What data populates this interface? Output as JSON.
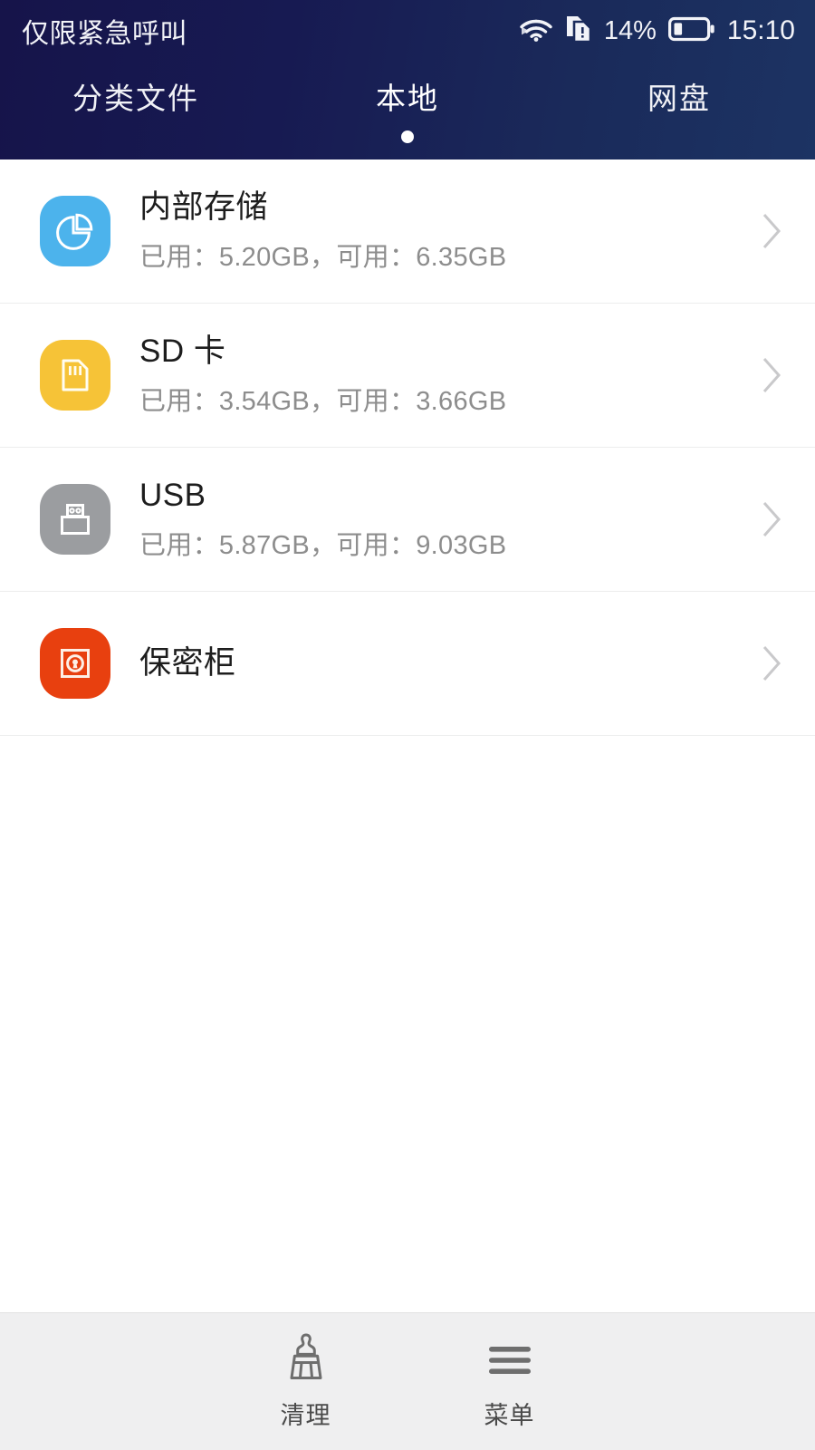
{
  "statusbar": {
    "carrier": "仅限紧急呼叫",
    "battery_percent": "14%",
    "clock": "15:10",
    "wifi_icon": "wifi-icon",
    "sim_icon": "sim-card-alert-icon",
    "battery_icon": "battery-icon"
  },
  "tabs": [
    {
      "label": "分类文件",
      "active": false
    },
    {
      "label": "本地",
      "active": true
    },
    {
      "label": "网盘",
      "active": false
    }
  ],
  "storage_list": [
    {
      "title": "内部存储",
      "subtitle": "已用：5.20GB，可用：6.35GB",
      "used": "5.20GB",
      "free": "6.35GB",
      "icon": "pie-chart-icon",
      "icon_color": "#4cb3ec"
    },
    {
      "title": "SD 卡",
      "subtitle": "已用：3.54GB，可用：3.66GB",
      "used": "3.54GB",
      "free": "3.66GB",
      "icon": "sd-card-icon",
      "icon_color": "#f6c337"
    },
    {
      "title": "USB",
      "subtitle": "已用：5.87GB，可用：9.03GB",
      "used": "5.87GB",
      "free": "9.03GB",
      "icon": "usb-drive-icon",
      "icon_color": "#9b9da0"
    },
    {
      "title": "保密柜",
      "subtitle": "",
      "used": "",
      "free": "",
      "icon": "safe-vault-icon",
      "icon_color": "#e8400f"
    }
  ],
  "bottombar": {
    "clean_label": "清理",
    "clean_icon": "brush-icon",
    "menu_label": "菜单",
    "menu_icon": "hamburger-menu-icon"
  },
  "colors": {
    "header_start": "#16144a",
    "header_end": "#1c3363",
    "divider": "#eceded",
    "bottombar_bg": "#efeff0",
    "title_text": "#1d1d1d",
    "sub_text": "#8d8d8d"
  }
}
